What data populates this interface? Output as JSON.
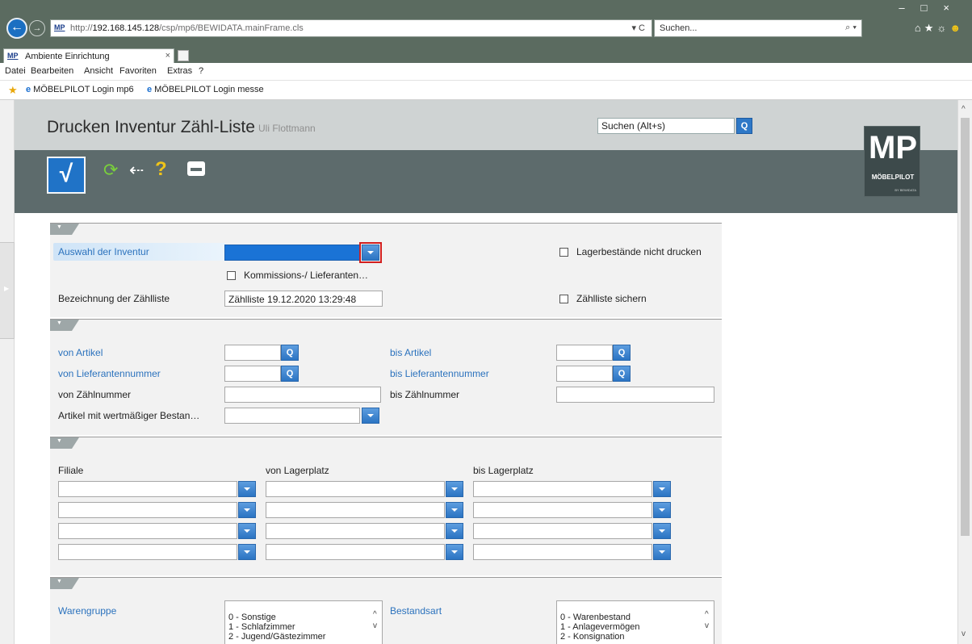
{
  "browser": {
    "url_prefix": "http://",
    "url_host": "192.168.145.128",
    "url_path": "/csp/mp6/BEWIDATA.mainFrame.cls",
    "url_logo": "MP",
    "addr_tools": "▾ C",
    "search_placeholder": "Suchen...",
    "tab_title": "Ambiente Einrichtung",
    "tab_close": "×",
    "menu": [
      "Datei",
      "Bearbeiten",
      "Ansicht",
      "Favoriten",
      "Extras",
      "?"
    ],
    "favorites": [
      "MÖBELPILOT Login mp6",
      "MÖBELPILOT Login messe"
    ]
  },
  "header": {
    "title": "Drucken Inventur Zähl-Liste",
    "user": "Uli Flottmann",
    "search_value": "Suchen (Alt+s)",
    "search_btn": "Q",
    "ok_label": "√",
    "logo_mp": "MP",
    "logo_name": "MÖBELPILOT",
    "logo_sub": "BY BEWIDATA"
  },
  "section1": {
    "auswahl_label": "Auswahl der Inventur",
    "auswahl_value": "",
    "kommission_label": "Kommissions-/ Lieferanten…",
    "bezeichnung_label": "Bezeichnung der Zählliste",
    "bezeichnung_value": "Zählliste 19.12.2020 13:29:48",
    "lager_label": "Lagerbestände nicht drucken",
    "sichern_label": "Zählliste sichern"
  },
  "section2": {
    "von_artikel": "von Artikel",
    "bis_artikel": "bis Artikel",
    "von_lief": "von Lieferantennummer",
    "bis_lief": "bis Lieferantennummer",
    "von_zaehl": "von Zählnummer",
    "bis_zaehl": "bis Zählnummer",
    "wert_label": "Artikel mit wertmäßiger Bestan…",
    "q": "Q"
  },
  "section3": {
    "filiale": "Filiale",
    "von_lager": "von Lagerplatz",
    "bis_lager": "bis Lagerplatz"
  },
  "section4": {
    "warengruppe": "Warengruppe",
    "warengruppe_items": [
      "0 - Sonstige",
      "1 - Schlafzimmer",
      "2 - Jugend/Gästezimmer"
    ],
    "bestandsart": "Bestandsart",
    "bestandsart_items": [
      "0 - Warenbestand",
      "1 - Anlagevermögen",
      "2 - Konsignation"
    ]
  },
  "colors": {
    "accent": "#2b72bd",
    "highlight": "#d21f1f",
    "header_bg": "#5d6b6c"
  }
}
